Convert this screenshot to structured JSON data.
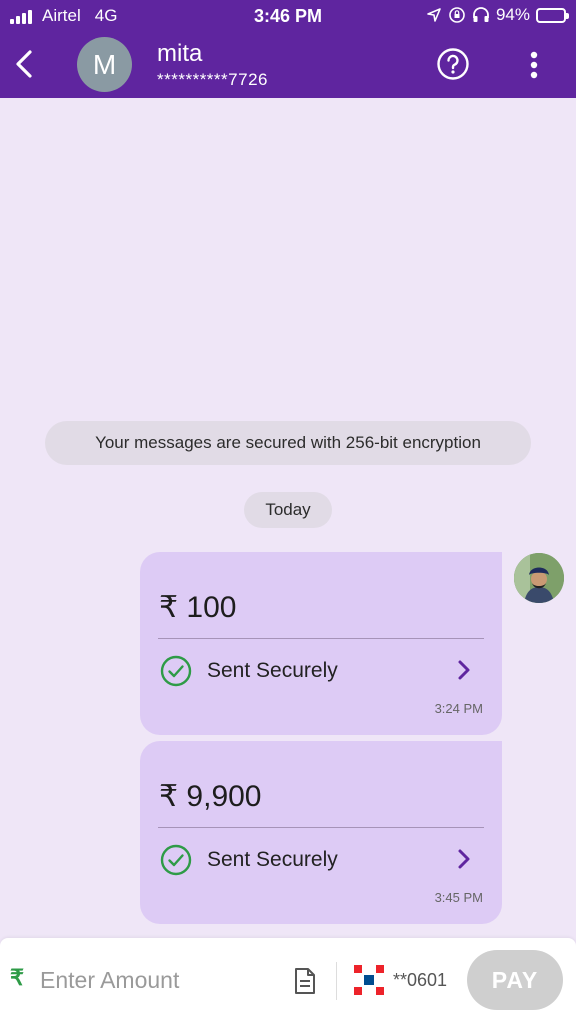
{
  "status_bar": {
    "carrier": "Airtel",
    "network": "4G",
    "time": "3:46 PM",
    "battery": "94%",
    "battery_level": 0.94
  },
  "header": {
    "avatar_letter": "M",
    "contact_name": "mita",
    "contact_number": "**********7726",
    "back_icon": "chevron-left-icon",
    "help_icon": "question-circle-icon",
    "menu_icon": "more-vertical-icon"
  },
  "chat": {
    "encryption_notice": "Your messages are secured with 256-bit encryption",
    "date_chip": "Today",
    "messages": [
      {
        "amount": "₹ 100",
        "status": "Sent Securely",
        "time": "3:24 PM"
      },
      {
        "amount": "₹ 9,900",
        "status": "Sent Securely",
        "time": "3:45 PM"
      }
    ]
  },
  "composer": {
    "currency_symbol": "₹",
    "placeholder": "Enter Amount",
    "bank_account": "**0601",
    "pay_label": "PAY"
  },
  "colors": {
    "brand_purple": "#5f259f",
    "background": "#efe6f7",
    "bubble": "#ddcbf5",
    "success_green": "#2e9b47",
    "pay_disabled": "#cfcfcf"
  }
}
